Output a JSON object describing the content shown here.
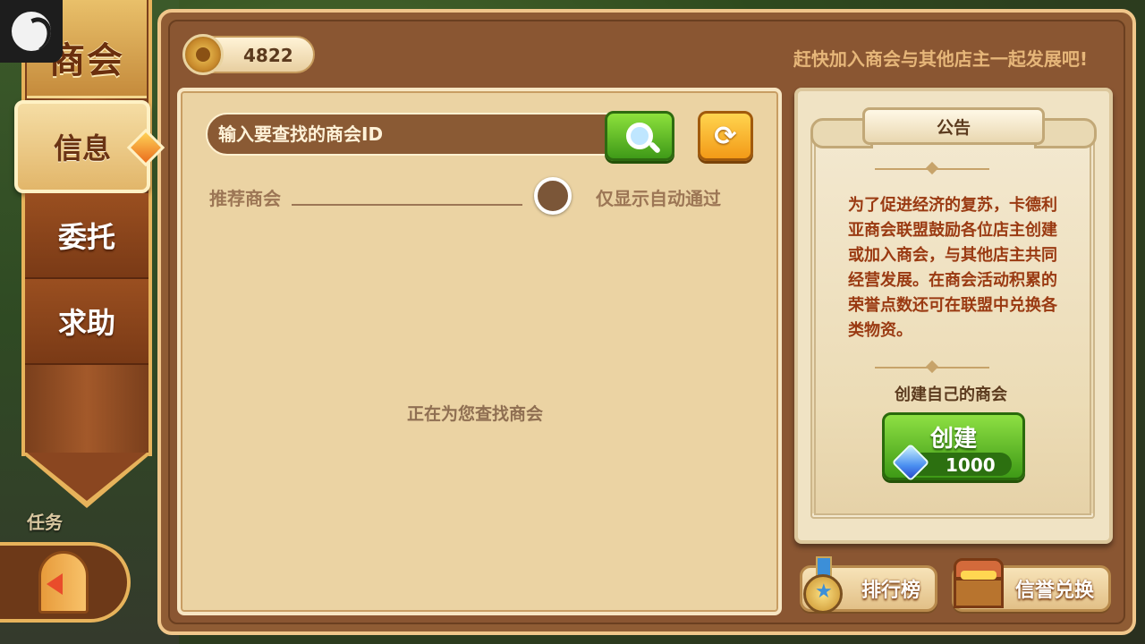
{
  "sidebar": {
    "title": "商会",
    "tabs": [
      {
        "label": "信息",
        "active": true
      },
      {
        "label": "委托",
        "active": false
      },
      {
        "label": "求助",
        "active": false
      }
    ],
    "task_label": "任务"
  },
  "header": {
    "currency_amount": "4822",
    "tagline": "赶快加入商会与其他店主一起发展吧!"
  },
  "search": {
    "placeholder": "输入要查找的商会ID",
    "refresh_glyph": "⟳"
  },
  "recommend": {
    "label": "推荐商会",
    "toggle_label": "仅显示自动通过",
    "loading_text": "正在为您查找商会"
  },
  "notice": {
    "title": "公告",
    "body": "为了促进经济的复苏，卡德利亚商会联盟鼓励各位店主创建或加入商会，与其他店主共同经营发展。在商会活动积累的荣誉点数还可在联盟中兑换各类物资。",
    "create_prompt": "创建自己的商会",
    "create_button": "创建",
    "create_cost": "1000"
  },
  "bottom_buttons": {
    "ranking": "排行榜",
    "exchange": "信誉兑换"
  },
  "colors": {
    "frame": "#8f5c34",
    "panel": "#ebd3a3",
    "green_button": "#3f9a18",
    "notice_text": "#9a3a12"
  }
}
